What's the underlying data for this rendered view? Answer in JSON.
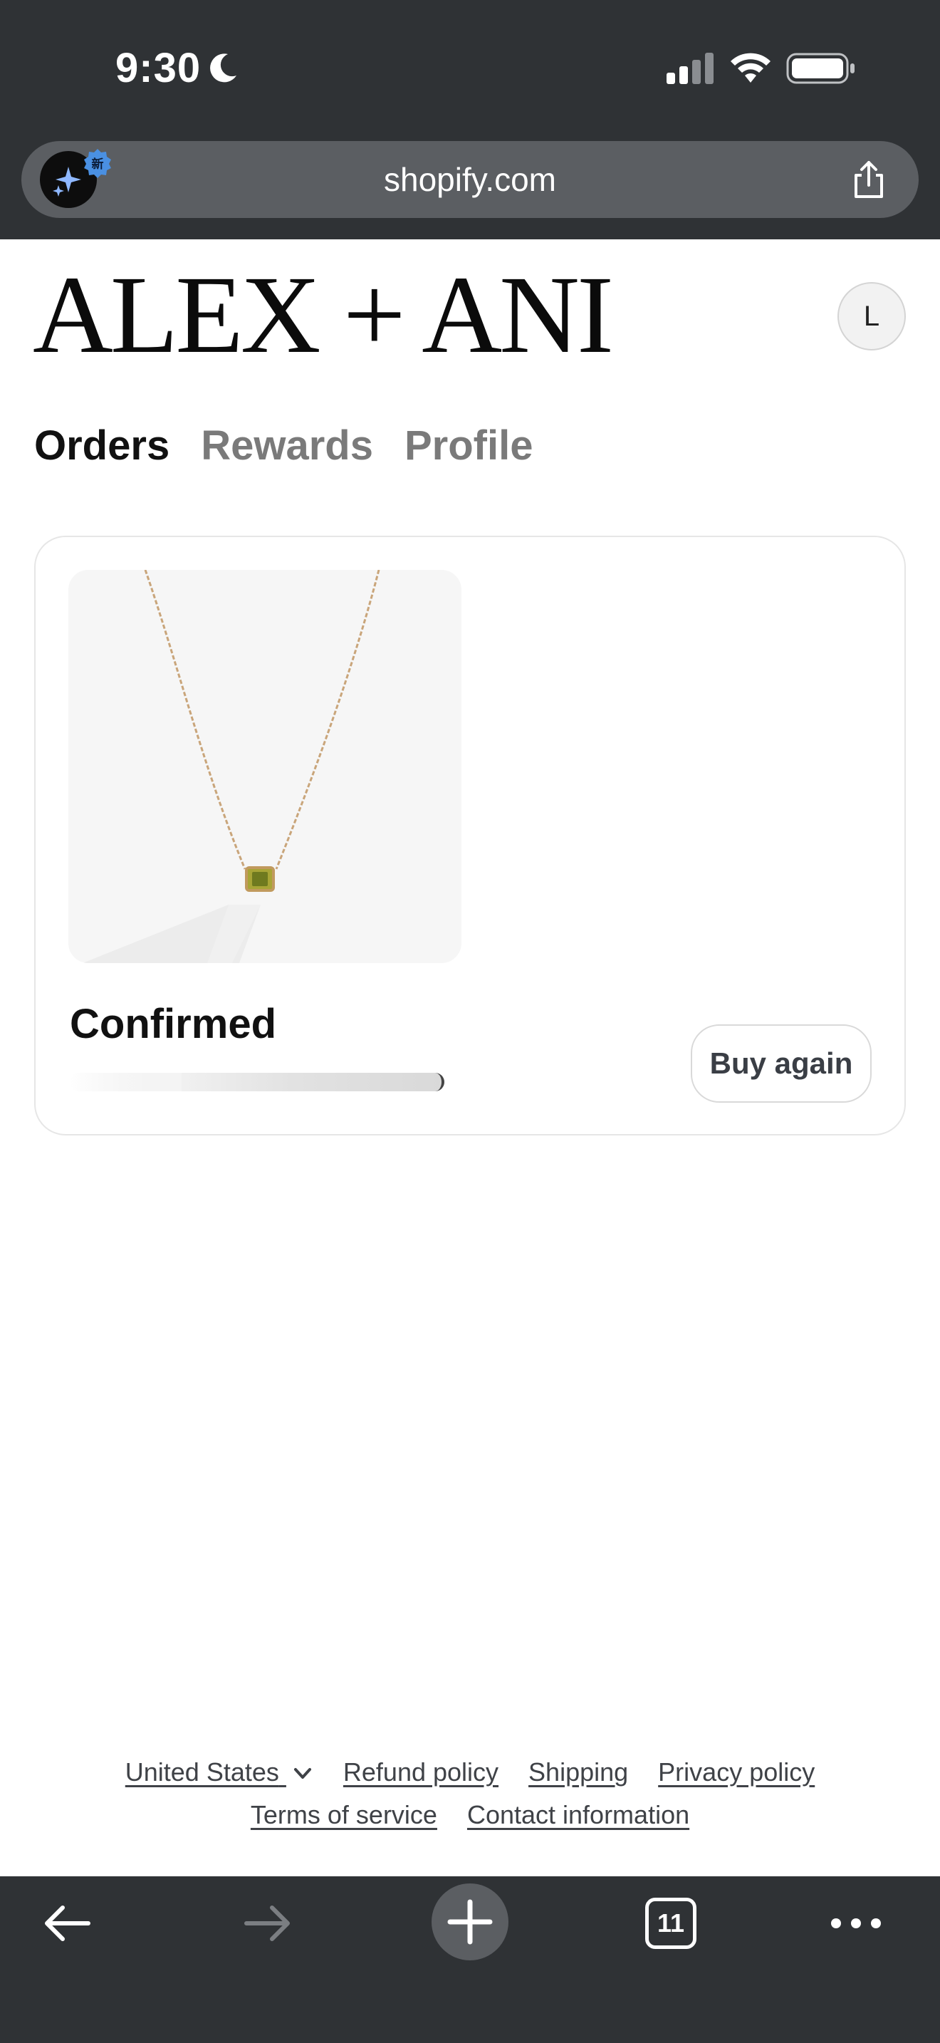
{
  "status_bar": {
    "time": "9:30"
  },
  "browser": {
    "url": "shopify.com",
    "ai_badge": "新",
    "open_tabs": "11"
  },
  "brand": {
    "logo_text": "ALEX + ANI"
  },
  "account": {
    "avatar_initial": "L"
  },
  "tabs": [
    {
      "label": "Orders",
      "active": true
    },
    {
      "label": "Rewards",
      "active": false
    },
    {
      "label": "Profile",
      "active": false
    }
  ],
  "order": {
    "status": "Confirmed",
    "buy_again_label": "Buy again",
    "product_image": "gold-chain-necklace-green-stone"
  },
  "footer": {
    "row1": [
      "United States",
      "Refund policy",
      "Shipping",
      "Privacy policy"
    ],
    "row2": [
      "Terms of service",
      "Contact information"
    ]
  },
  "colors": {
    "chrome": "#2f3235",
    "url_bar": "#5b5e62",
    "tab_inactive": "#7a7a7a",
    "card_border": "#e6e6e6"
  }
}
